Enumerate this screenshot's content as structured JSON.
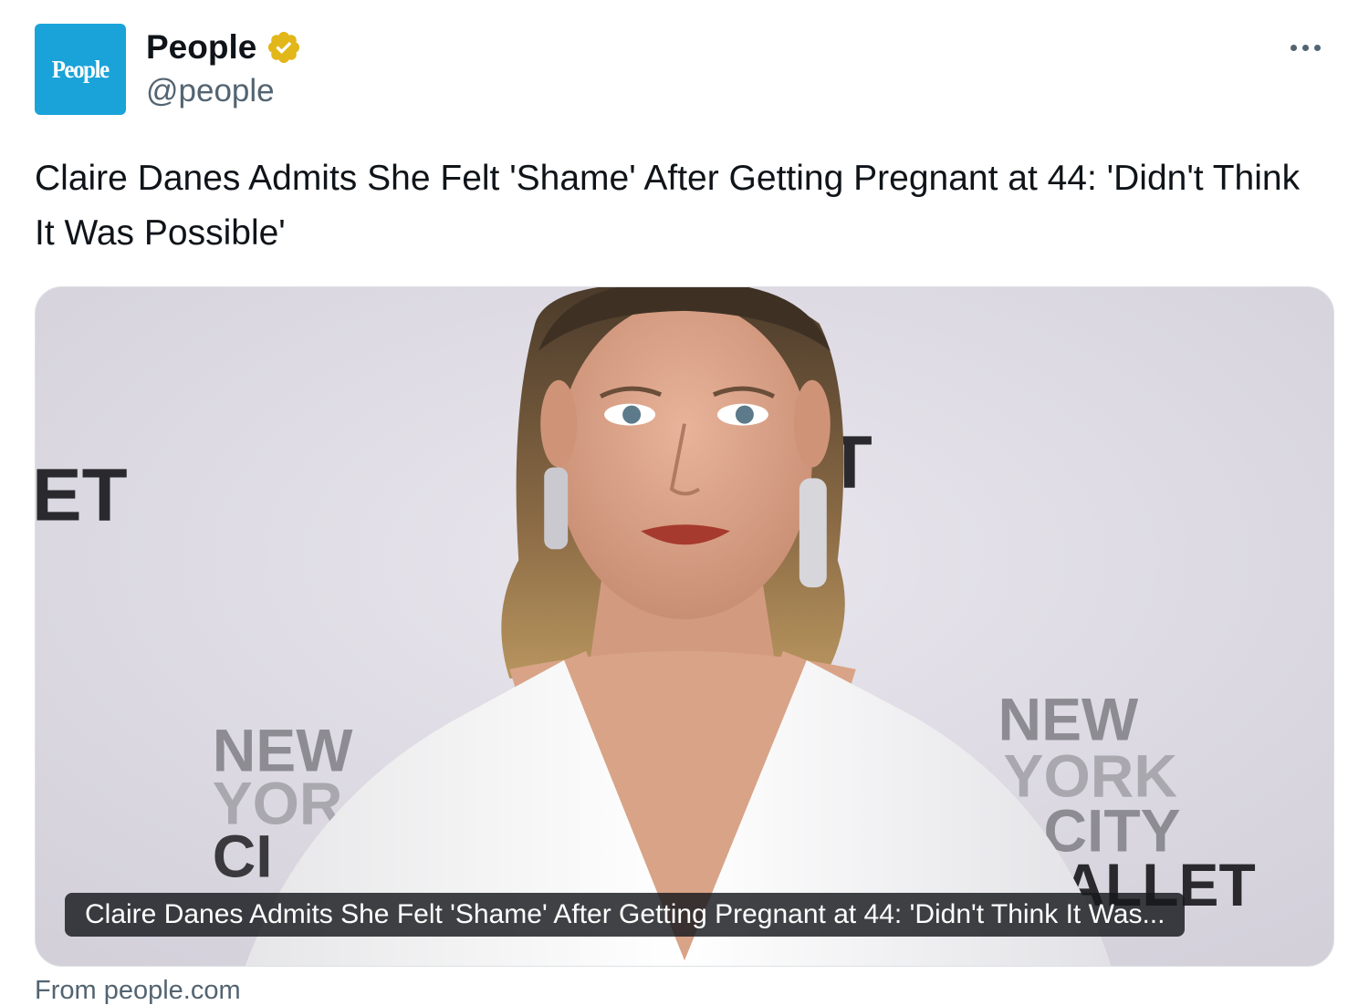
{
  "account": {
    "avatar_text": "People",
    "display_name": "People",
    "handle": "@people"
  },
  "tweet": {
    "text": "Claire Danes Admits She Felt 'Shame' After Getting Pregnant at 44: 'Didn't Think It Was Possible'"
  },
  "card": {
    "caption": "Claire Danes Admits She Felt 'Shame' After Getting Pregnant at 44: 'Didn't Think It Was...",
    "source": "From people.com",
    "backdrop_left_text": "ET",
    "backdrop_mid_text": "T",
    "backdrop_left_logo": [
      "NEW",
      "YOR",
      "CI"
    ],
    "backdrop_right_logo": [
      "NEW",
      "YORK",
      "CITY",
      "ALLET"
    ]
  },
  "icons": {
    "verified": "verified-gold-badge-icon",
    "more": "more-options-icon"
  },
  "colors": {
    "avatar_bg": "#1aa3d9",
    "verified_gold": "#e2b719",
    "secondary_text": "#536471",
    "caption_bg": "#16181c"
  }
}
